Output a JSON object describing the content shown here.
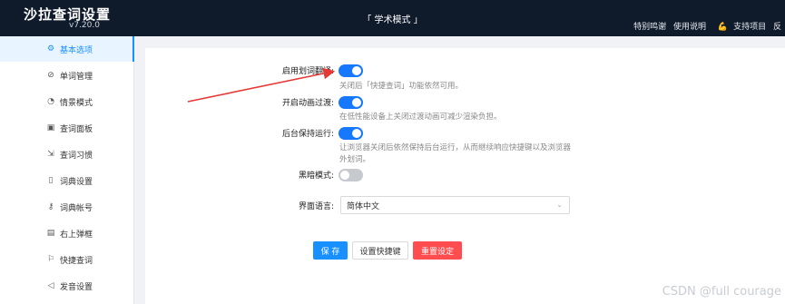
{
  "header": {
    "title": "沙拉查词设置",
    "version": "v7.20.0",
    "mode": "「 学术模式 」",
    "links": [
      "特别鸣谢",
      "使用说明",
      "支持项目",
      "反"
    ]
  },
  "sidebar": {
    "items": [
      {
        "label": "基本选项",
        "icon": "gear-icon",
        "glyph": "⚙"
      },
      {
        "label": "单词管理",
        "icon": "tag-icon",
        "glyph": "⊘"
      },
      {
        "label": "情景模式",
        "icon": "gauge-icon",
        "glyph": "◔"
      },
      {
        "label": "查词面板",
        "icon": "panel-icon",
        "glyph": "▣"
      },
      {
        "label": "查词习惯",
        "icon": "cursor-icon",
        "glyph": "⇲"
      },
      {
        "label": "词典设置",
        "icon": "book-icon",
        "glyph": "▯"
      },
      {
        "label": "词典帐号",
        "icon": "key-icon",
        "glyph": "⚷"
      },
      {
        "label": "右上弹框",
        "icon": "layout-icon",
        "glyph": "▤"
      },
      {
        "label": "快捷查词",
        "icon": "flag-icon",
        "glyph": "⚐"
      },
      {
        "label": "发音设置",
        "icon": "speaker-icon",
        "glyph": "◁"
      }
    ]
  },
  "settings": {
    "translate_label": "启用划词翻译:",
    "translate_desc": "关闭后「快捷查词」功能依然可用。",
    "animation_label": "开启动画过渡:",
    "animation_desc": "在低性能设备上关闭过渡动画可减少渲染负担。",
    "background_label": "后台保持运行:",
    "background_desc_1": "让浏览器关闭后依然保持后台运行，从而继续响应快捷键以及浏览器",
    "background_desc_2": "外划词。",
    "dark_label": "黑暗模式:",
    "language_label": "界面语言:",
    "language_value": "简体中文"
  },
  "toggles": {
    "translate": true,
    "animation": true,
    "background": true,
    "dark": false
  },
  "buttons": {
    "save": "保 存",
    "hotkey": "设置快捷键",
    "reset": "重置设定"
  },
  "watermark": "CSDN @full courage",
  "colors": {
    "accent": "#1890ff",
    "header_bg": "#0f1b2b",
    "danger": "#ff4d4f",
    "arrow": "#e53935"
  }
}
